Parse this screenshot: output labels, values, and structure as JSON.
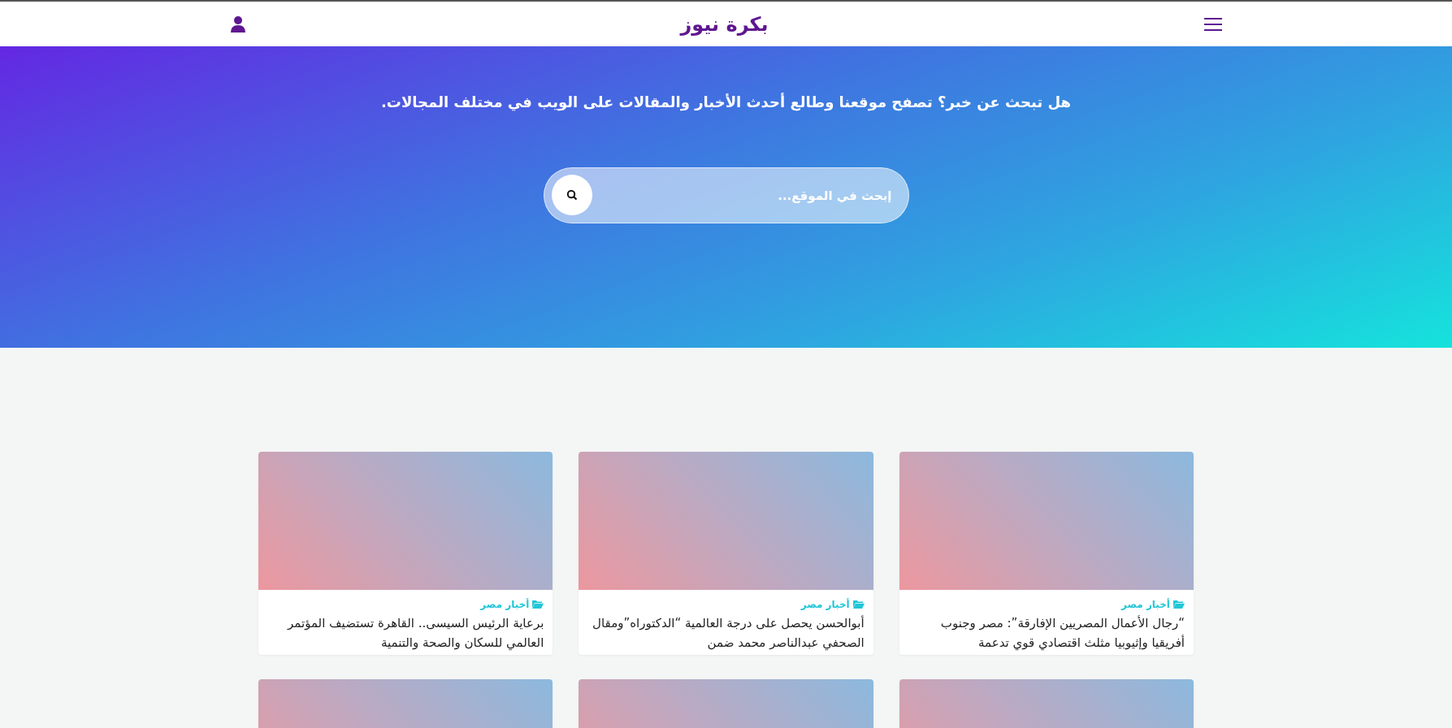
{
  "header": {
    "logo": "بكرة نيوز"
  },
  "hero": {
    "headline": "هل تبحث عن خبر؟ تصفح موقعنا وطالع أحدث الأخبار والمقالات على الويب في مختلف المجالات.",
    "search": {
      "placeholder": "إبحث في الموقع..."
    }
  },
  "cards": [
    {
      "kind": "article",
      "category": "أخبار مصر",
      "title": "“رجال الأعمال المصريين الإفارقة”: مصر وجنوب أفريقيا وإثيوبيا مثلث اقتصادي قوي تدعمة"
    },
    {
      "kind": "article",
      "category": "أخبار مصر",
      "title": "أبوالحسن يحصل على درجة العالمية “الدكتوراه”ومقال الصحفي عبدالناصر محمد ضمن"
    },
    {
      "kind": "article",
      "category": "أخبار مصر",
      "title": "برعاية الرئيس السيسى.. القاهرة تستضيف المؤتمر العالمي للسكان والصحة والتنمية"
    },
    {
      "kind": "image-only"
    },
    {
      "kind": "image-only"
    },
    {
      "kind": "image-only"
    }
  ]
}
